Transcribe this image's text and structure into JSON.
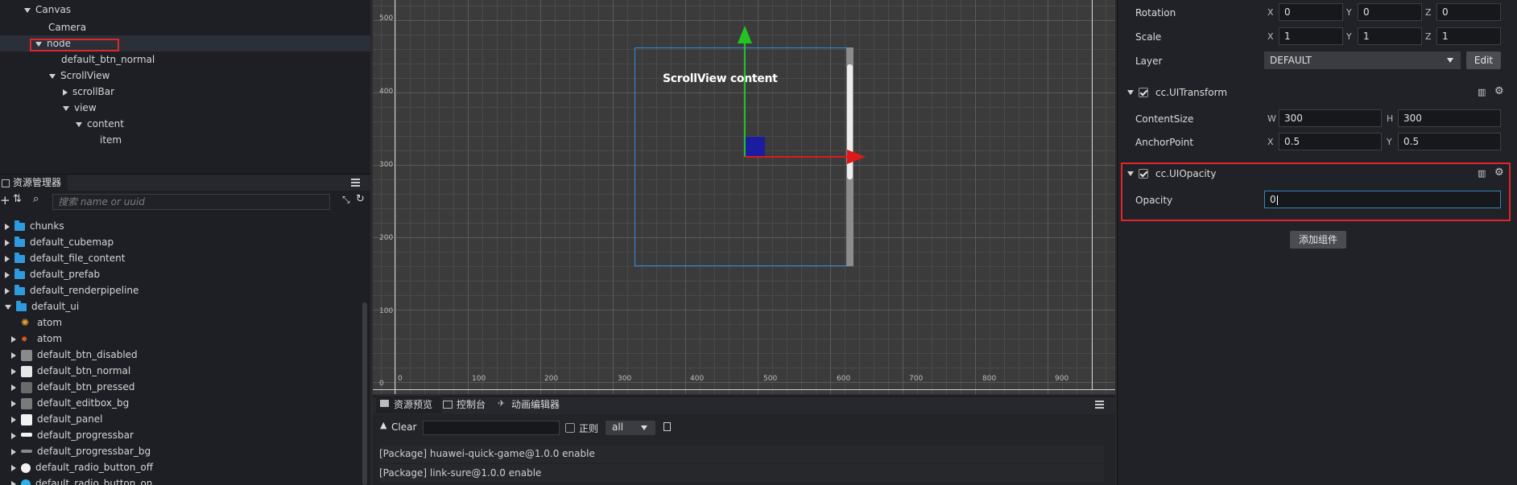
{
  "hierarchy": {
    "items": [
      {
        "label": "Canvas",
        "expanded": true
      },
      {
        "label": "Camera"
      },
      {
        "label": "node",
        "expanded": true,
        "selected": true
      },
      {
        "label": "default_btn_normal"
      },
      {
        "label": "ScrollView",
        "expanded": true
      },
      {
        "label": "scrollBar",
        "expanded": false
      },
      {
        "label": "view",
        "expanded": true
      },
      {
        "label": "content",
        "expanded": true
      },
      {
        "label": "item"
      }
    ]
  },
  "assets": {
    "tab_label": "资源管理器",
    "search_placeholder": "搜索 name or uuid",
    "items": [
      {
        "label": "chunks"
      },
      {
        "label": "default_cubemap"
      },
      {
        "label": "default_file_content"
      },
      {
        "label": "default_prefab"
      },
      {
        "label": "default_renderpipeline"
      },
      {
        "label": "default_ui"
      },
      {
        "label": "atom"
      },
      {
        "label": "atom"
      },
      {
        "label": "default_btn_disabled"
      },
      {
        "label": "default_btn_normal"
      },
      {
        "label": "default_btn_pressed"
      },
      {
        "label": "default_editbox_bg"
      },
      {
        "label": "default_panel"
      },
      {
        "label": "default_progressbar"
      },
      {
        "label": "default_progressbar_bg"
      },
      {
        "label": "default_radio_button_off"
      },
      {
        "label": "default_radio_button_on"
      }
    ]
  },
  "scene": {
    "content_label": "ScrollView content",
    "y_ticks": [
      "500",
      "400",
      "300",
      "200",
      "100",
      "0"
    ],
    "x_ticks": [
      "0",
      "100",
      "200",
      "300",
      "400",
      "500",
      "600",
      "700",
      "800",
      "900"
    ]
  },
  "console": {
    "tabs": [
      "资源预览",
      "控制台",
      "动画编辑器"
    ],
    "clear_label": "Clear",
    "regex_label": "正则",
    "filter_value": "all",
    "lines": [
      "[Package] huawei-quick-game@1.0.0 enable",
      "[Package] link-sure@1.0.0 enable"
    ]
  },
  "inspector": {
    "rotation": {
      "label": "Rotation",
      "x": "0",
      "y": "0",
      "z": "0"
    },
    "scale": {
      "label": "Scale",
      "x": "1",
      "y": "1",
      "z": "1"
    },
    "layer": {
      "label": "Layer",
      "value": "DEFAULT",
      "edit_label": "Edit"
    },
    "axis": {
      "x": "X",
      "y": "Y",
      "z": "Z",
      "w": "W",
      "h": "H"
    },
    "uitransform": {
      "title": "cc.UITransform",
      "content_size": {
        "label": "ContentSize",
        "w": "300",
        "h": "300"
      },
      "anchor_point": {
        "label": "AnchorPoint",
        "x": "0.5",
        "y": "0.5"
      }
    },
    "uiopacity": {
      "title": "cc.UIOpacity",
      "opacity": {
        "label": "Opacity",
        "value": "0"
      }
    },
    "add_component_label": "添加组件"
  },
  "colors": {
    "accent_red": "#e0262d",
    "gizmo_green": "#22c422",
    "gizmo_red": "#e01818",
    "folder_blue": "#2e9be0",
    "scene_bg": "#3b3b3b"
  }
}
